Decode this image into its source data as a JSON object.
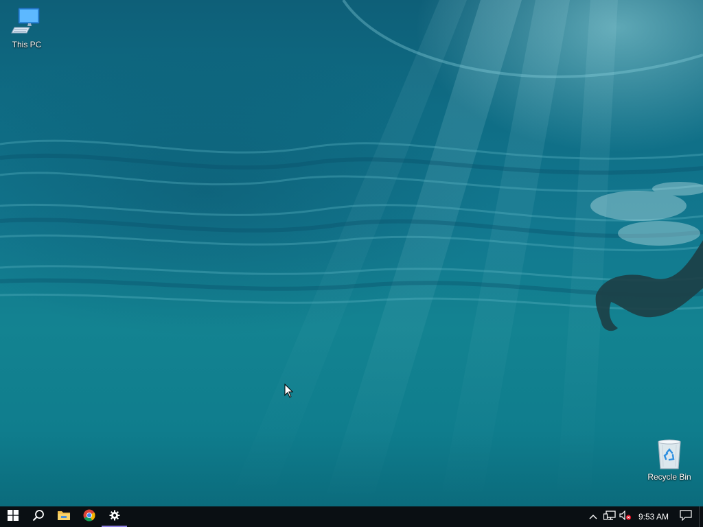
{
  "desktop": {
    "icons": [
      {
        "label": "This PC",
        "icon": "computer-icon"
      },
      {
        "label": "Recycle Bin",
        "icon": "recycle-bin-icon"
      }
    ]
  },
  "taskbar": {
    "buttons": [
      {
        "icon": "windows-start-icon"
      },
      {
        "icon": "search-icon"
      },
      {
        "icon": "file-explorer-icon"
      },
      {
        "icon": "chrome-icon"
      },
      {
        "icon": "settings-gear-icon",
        "active": true
      }
    ],
    "tray": {
      "icons": [
        "chevron-up-icon",
        "network-icon",
        "volume-muted-icon"
      ],
      "time": "9:53 AM",
      "action_center_icon": "action-center-icon"
    },
    "active_indicator_color": "#8e7fe0"
  },
  "colors": {
    "taskbar_bg": "#0a0f13",
    "wallpaper_teal": "#12788f"
  }
}
